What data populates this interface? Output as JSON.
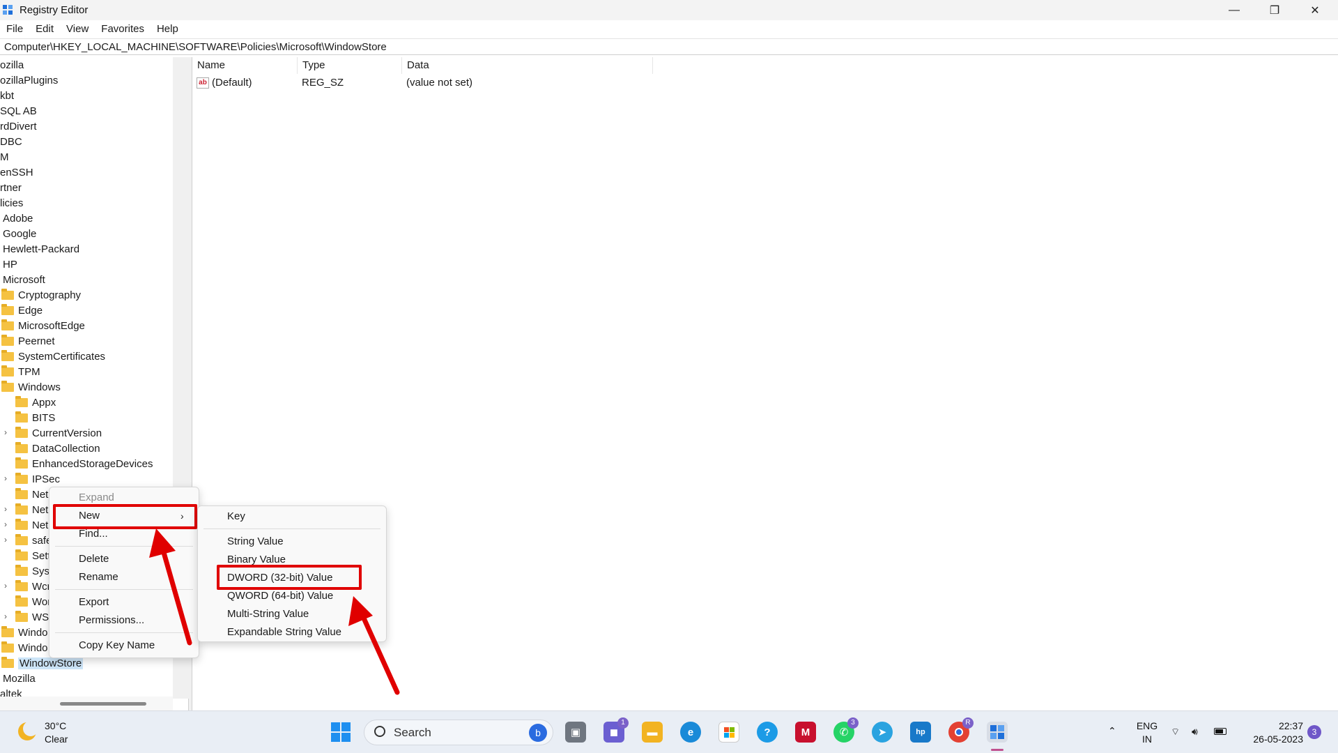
{
  "window": {
    "title": "Registry Editor",
    "controls": {
      "minimize": "—",
      "maximize": "❐",
      "close": "✕"
    }
  },
  "menubar": [
    "File",
    "Edit",
    "View",
    "Favorites",
    "Help"
  ],
  "address": "Computer\\HKEY_LOCAL_MACHINE\\SOFTWARE\\Policies\\Microsoft\\WindowStore",
  "tree": [
    "ozilla",
    "ozillaPlugins",
    "kbt",
    "SQL AB",
    "rdDivert",
    "DBC",
    "M",
    "enSSH",
    "rtner",
    "licies",
    "Adobe",
    "Google",
    "Hewlett-Packard",
    "HP",
    "Microsoft",
    "Cryptography",
    "Edge",
    "MicrosoftEdge",
    "Peernet",
    "SystemCertificates",
    "TPM",
    "Windows",
    "Appx",
    "BITS",
    "CurrentVersion",
    "DataCollection",
    "EnhancedStorageDevices",
    "IPSec",
    "Net",
    "Net",
    "Net",
    "safe",
    "Sett",
    "Syst",
    "Wcr",
    "Wor",
    "WSI",
    "Windo",
    "Windo",
    "WindowStore",
    "Mozilla",
    "altek"
  ],
  "values_pane": {
    "columns": [
      "Name",
      "Type",
      "Data"
    ],
    "rows": [
      {
        "name": "(Default)",
        "type": "REG_SZ",
        "data": "(value not set)"
      }
    ]
  },
  "context_menu": {
    "items": [
      "Expand",
      "New",
      "Find...",
      "Delete",
      "Rename",
      "Export",
      "Permissions...",
      "Copy Key Name"
    ],
    "highlighted": "New"
  },
  "new_submenu": {
    "items": [
      "Key",
      "String Value",
      "Binary Value",
      "DWORD (32-bit) Value",
      "QWORD (64-bit) Value",
      "Multi-String Value",
      "Expandable String Value"
    ],
    "highlighted": "DWORD (32-bit) Value"
  },
  "taskbar": {
    "weather_temp": "30°C",
    "weather_desc": "Clear",
    "search_label": "Search",
    "badges": [
      "1",
      "3",
      "R",
      "3"
    ],
    "lang_top": "ENG",
    "lang_bottom": "IN",
    "time": "22:37",
    "date": "26-05-2023"
  },
  "colors": {
    "highlight_red": "#e00000",
    "selection": "#cce4f7",
    "folder": "#f5c242"
  }
}
